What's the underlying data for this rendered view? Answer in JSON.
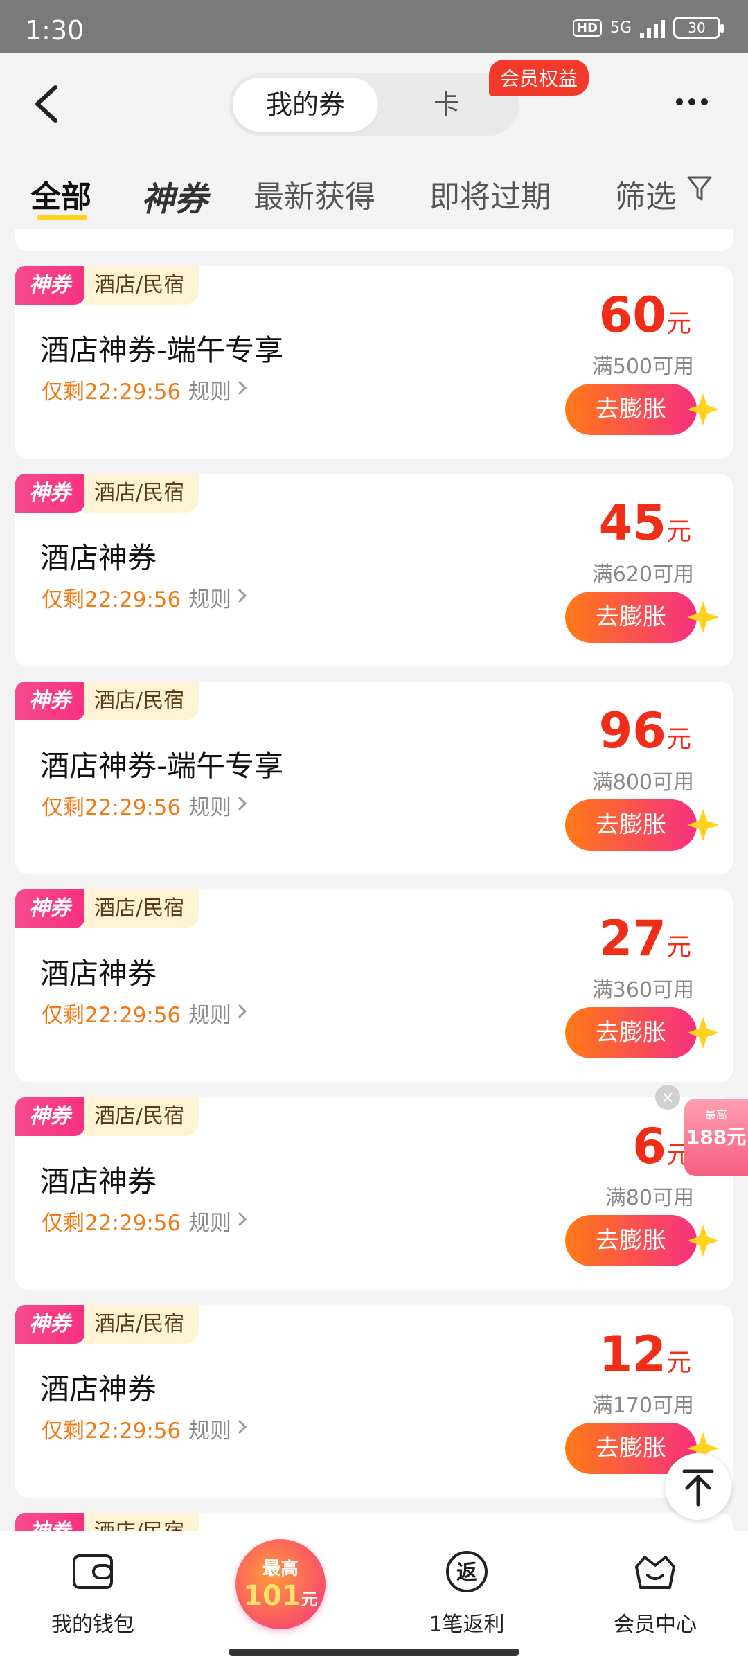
{
  "status_bar": {
    "time": "1:30",
    "hd": "HD",
    "network": "5G",
    "battery": "30"
  },
  "header": {
    "segment_active": "我的券",
    "segment_inactive": "卡",
    "vip_badge": "会员权益"
  },
  "tabs": [
    "全部",
    "神券",
    "最新获得",
    "即将过期",
    "筛选"
  ],
  "coupon_common": {
    "god_label": "神券",
    "category": "酒店/民宿",
    "countdown": "仅剩22:29:56",
    "rule_label": "规则",
    "unit": "元",
    "button_label": "去膨胀"
  },
  "coupons": [
    {
      "title": "酒店神券-端午专享",
      "amount": "60",
      "condition": "满500可用"
    },
    {
      "title": "酒店神券",
      "amount": "45",
      "condition": "满620可用"
    },
    {
      "title": "酒店神券-端午专享",
      "amount": "96",
      "condition": "满800可用"
    },
    {
      "title": "酒店神券",
      "amount": "27",
      "condition": "满360可用"
    },
    {
      "title": "酒店神券",
      "amount": "6",
      "condition": "满80可用"
    },
    {
      "title": "酒店神券",
      "amount": "12",
      "condition": "满170可用"
    }
  ],
  "floating_promo": {
    "line1": "最高",
    "line2": "188元"
  },
  "bottom_nav": {
    "wallet": "我的钱包",
    "center_line1": "最高",
    "center_amount": "101",
    "center_unit": "元",
    "rebate": "1笔返利",
    "rebate_icon_text": "返",
    "member": "会员中心"
  },
  "colors": {
    "accent_red": "#ef2d18",
    "orange": "#f07a14",
    "pink": "#f6307f",
    "yellow": "#ffd21e"
  }
}
